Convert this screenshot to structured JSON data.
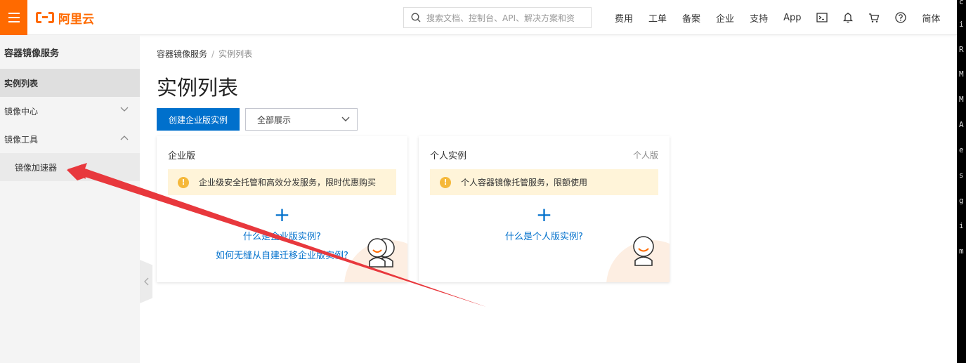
{
  "header": {
    "logo_text": "阿里云",
    "search_placeholder": "搜索文档、控制台、API、解决方案和资",
    "nav": [
      "费用",
      "工单",
      "备案",
      "企业",
      "支持",
      "App"
    ],
    "lang": "简体"
  },
  "sidebar": {
    "title": "容器镜像服务",
    "items": [
      {
        "label": "实例列表"
      },
      {
        "label": "镜像中心"
      },
      {
        "label": "镜像工具"
      }
    ],
    "sub_items": [
      {
        "label": "镜像加速器"
      }
    ]
  },
  "breadcrumb": {
    "root": "容器镜像服务",
    "separator": "/",
    "current": "实例列表"
  },
  "page": {
    "title": "实例列表",
    "create_button": "创建企业版实例",
    "filter_select": "全部展示"
  },
  "cards": {
    "enterprise": {
      "title": "企业版",
      "notice": "企业级安全托管和高效分发服务，限时优惠购买",
      "link1": "什么是企业版实例?",
      "link2": "如何无缝从自建迁移企业版实例?"
    },
    "personal": {
      "title": "个人实例",
      "tag": "个人版",
      "notice": "个人容器镜像托管服务，限额使用",
      "link1": "什么是个人版实例?"
    }
  },
  "right_strip": [
    "c",
    "i",
    "R",
    "M",
    "M",
    "A",
    "e",
    "s",
    "g",
    "i",
    "m"
  ],
  "colors": {
    "brand": "#ff6a00",
    "primary": "#0070cc",
    "notice_bg": "#fff4d9",
    "annotation_arrow": "#e8383d"
  }
}
